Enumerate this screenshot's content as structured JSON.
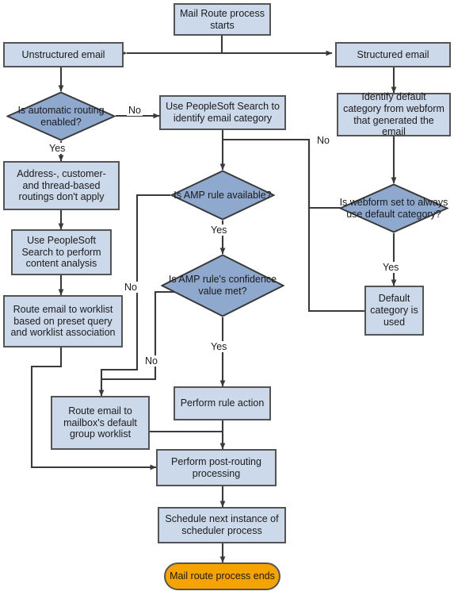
{
  "diagram": {
    "title": "Mail Route process flowchart",
    "colors": {
      "process_fill": "#ccd9ea",
      "decision_fill": "#8fa8ce",
      "terminator_fill": "#f5a300",
      "stroke": "#545454",
      "text": "#1b1b1b",
      "background": "#ffffff"
    },
    "nodes": {
      "start": {
        "label": "Mail Route process starts",
        "shape": "process"
      },
      "unstructured_email": {
        "label": "Unstructured email",
        "shape": "process"
      },
      "structured_email": {
        "label": "Structured email",
        "shape": "process"
      },
      "is_automatic_routing_enabled": {
        "label": "Is automatic routing enabled?",
        "shape": "decision"
      },
      "use_peoplesoft_search_identify": {
        "label": "Use PeopleSoft Search to identify email category",
        "shape": "process"
      },
      "identify_default_category": {
        "label": "Identify default category from webform that generated the email",
        "shape": "process"
      },
      "address_customer_thread": {
        "label": "Address-, customer- and thread-based routings don't apply",
        "shape": "process"
      },
      "is_amp_rule_available": {
        "label": "Is AMP rule available?",
        "shape": "decision"
      },
      "is_webform_set_default": {
        "label": "Is webform set to always use default category?",
        "shape": "decision"
      },
      "use_peoplesoft_content_analysis": {
        "label": "Use PeopleSoft Search to perform content analysis",
        "shape": "process"
      },
      "is_amp_confidence_met": {
        "label": "Is AMP rule's confidence value met?",
        "shape": "decision"
      },
      "default_category_used": {
        "label": "Default category is used",
        "shape": "process"
      },
      "route_email_worklist": {
        "label": "Route email to worklist based on preset query and worklist association",
        "shape": "process"
      },
      "perform_rule_action": {
        "label": "Perform rule action",
        "shape": "process"
      },
      "route_email_mailbox_default": {
        "label": "Route email to mailbox's default group worklist",
        "shape": "process"
      },
      "perform_post_routing": {
        "label": "Perform post-routing processing",
        "shape": "process"
      },
      "schedule_next_instance": {
        "label": "Schedule next instance of scheduler process",
        "shape": "process"
      },
      "end": {
        "label": "Mail route process ends",
        "shape": "terminator"
      }
    },
    "edge_labels": {
      "routing_no": "No",
      "routing_yes": "Yes",
      "amp_available_no": "No",
      "amp_available_yes": "Yes",
      "confidence_no": "No",
      "confidence_yes": "Yes",
      "webform_no": "No",
      "webform_yes": "Yes"
    }
  }
}
